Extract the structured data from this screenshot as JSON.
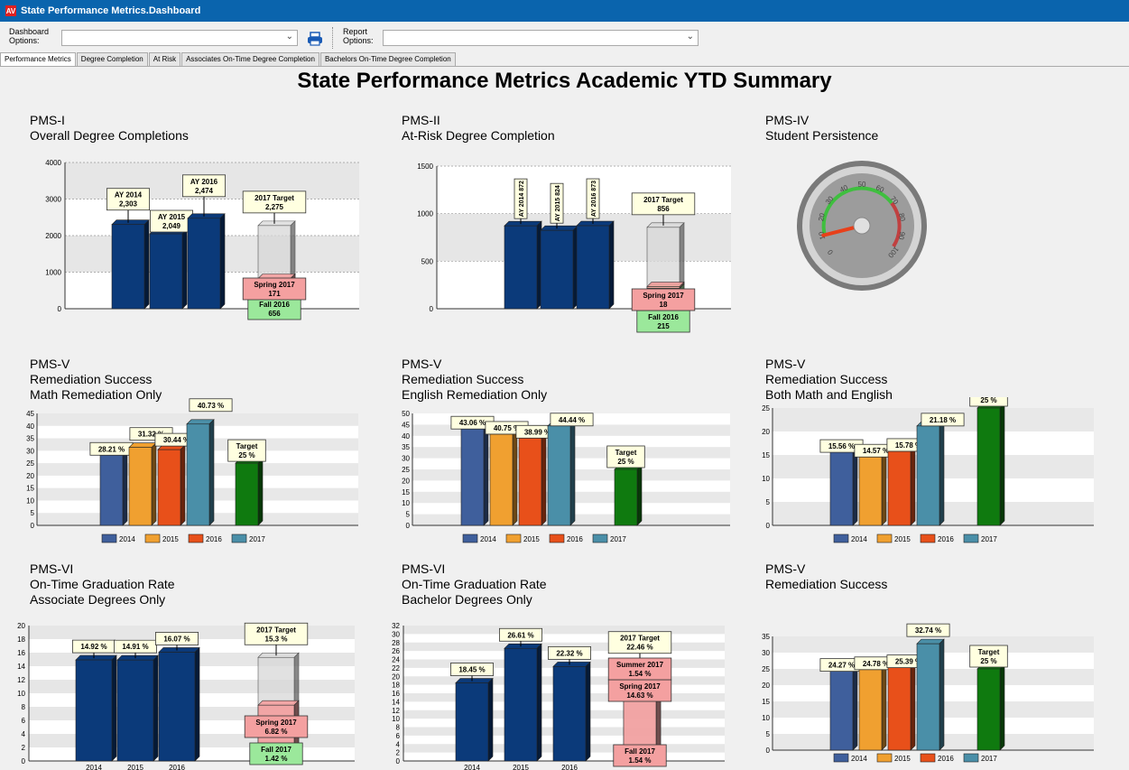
{
  "window": {
    "title": "State Performance Metrics.Dashboard",
    "app_icon": "app-logo-icon"
  },
  "toolbar": {
    "dashboard_label": "Dashboard Options:",
    "dashboard_value": "",
    "report_label": "Report Options:",
    "report_value": "",
    "print_icon": "printer-icon"
  },
  "tabs": [
    {
      "label": "Performance Metrics",
      "active": true
    },
    {
      "label": "Degree Completion"
    },
    {
      "label": "At Risk"
    },
    {
      "label": "Associates On-Time Degree Completion"
    },
    {
      "label": "Bachelors On-Time Degree Completion"
    }
  ],
  "page_title": "State Performance Metrics Academic YTD Summary",
  "panels": {
    "p1": {
      "code": "PMS-I",
      "line1": "Overall Degree Completions",
      "line2": ""
    },
    "p2": {
      "code": "PMS-II",
      "line1": "At-Risk Degree Completion",
      "line2": ""
    },
    "p3": {
      "code": "PMS-IV",
      "line1": "Student Persistence",
      "line2": ""
    },
    "p4": {
      "code": "PMS-V",
      "line1": "Remediation Success",
      "line2": "Math Remediation Only"
    },
    "p5": {
      "code": "PMS-V",
      "line1": "Remediation Success",
      "line2": "English Remediation Only"
    },
    "p6": {
      "code": "PMS-V",
      "line1": "Remediation Success",
      "line2": "Both Math and English"
    },
    "p7": {
      "code": "PMS-VI",
      "line1": "On-Time Graduation Rate",
      "line2": "Associate Degrees Only"
    },
    "p8": {
      "code": "PMS-VI",
      "line1": "On-Time Graduation Rate",
      "line2": "Bachelor Degrees Only"
    },
    "p9": {
      "code": "PMS-V",
      "line1": "Remediation Success",
      "line2": ""
    }
  },
  "colors": {
    "navy": "#0b3a7a",
    "blue": "#3f5f9c",
    "orange": "#f0a030",
    "red": "#e8501a",
    "teal": "#4a8fa8",
    "green": "#0f7a0f",
    "target_gray": "#d8d8d8",
    "spring_pink": "#f4a0a0",
    "fall_green": "#9be89b"
  },
  "chart_data": [
    {
      "id": "pms1",
      "type": "bar",
      "ylim": [
        0,
        4000
      ],
      "yticks": [
        0,
        1000,
        2000,
        3000,
        4000
      ],
      "bars": [
        {
          "label": "AY 2014",
          "value": 2303,
          "value_label": "2,303"
        },
        {
          "label": "AY 2015",
          "value": 2049,
          "value_label": "2,049"
        },
        {
          "label": "AY 2016",
          "value": 2474,
          "value_label": "2,474"
        }
      ],
      "target": {
        "label": "2017 Target",
        "value": 2275,
        "value_label": "2,275"
      },
      "stack": [
        {
          "label": "Fall 2016",
          "value": 656,
          "value_label": "656",
          "color": "fall"
        },
        {
          "label": "Spring 2017",
          "value": 171,
          "value_label": "171",
          "color": "spring"
        }
      ]
    },
    {
      "id": "pms2",
      "type": "bar",
      "ylim": [
        0,
        1500
      ],
      "yticks": [
        0,
        500,
        1000,
        1500
      ],
      "bars": [
        {
          "label": "AY 2014",
          "value": 872,
          "value_label": "872"
        },
        {
          "label": "AY 2015",
          "value": 824,
          "value_label": "824"
        },
        {
          "label": "AY 2016",
          "value": 873,
          "value_label": "873"
        }
      ],
      "target": {
        "label": "2017 Target",
        "value": 856,
        "value_label": "856"
      },
      "stack": [
        {
          "label": "Fall 2016",
          "value": 215,
          "value_label": "215",
          "color": "fall"
        },
        {
          "label": "Spring 2017",
          "value": 18,
          "value_label": "18",
          "color": "spring"
        }
      ]
    },
    {
      "id": "pms4",
      "type": "gauge",
      "tick_labels": [
        "0",
        "10",
        "20",
        "30",
        "40",
        "50",
        "60",
        "70",
        "80",
        "90",
        "100"
      ],
      "needle_value": 10
    },
    {
      "id": "pms5a",
      "type": "bar",
      "ylim": [
        0,
        45
      ],
      "yticks": [
        0,
        5,
        10,
        15,
        20,
        25,
        30,
        35,
        40,
        45
      ],
      "series": [
        {
          "name": "2014",
          "value": 28.21,
          "value_label": "28.21 %"
        },
        {
          "name": "2015",
          "value": 31.32,
          "value_label": "31.32 %"
        },
        {
          "name": "2016",
          "value": 30.44,
          "value_label": "30.44 %"
        },
        {
          "name": "2017",
          "value": 40.73,
          "value_label": "40.73 %"
        }
      ],
      "target": {
        "label": "Target",
        "value": 25,
        "value_label": "25 %"
      }
    },
    {
      "id": "pms5b",
      "type": "bar",
      "ylim": [
        0,
        50
      ],
      "yticks": [
        0,
        5,
        10,
        15,
        20,
        25,
        30,
        35,
        40,
        45,
        50
      ],
      "series": [
        {
          "name": "2014",
          "value": 43.06,
          "value_label": "43.06 %"
        },
        {
          "name": "2015",
          "value": 40.75,
          "value_label": "40.75 %"
        },
        {
          "name": "2016",
          "value": 38.99,
          "value_label": "38.99 %"
        },
        {
          "name": "2017",
          "value": 44.44,
          "value_label": "44.44 %"
        }
      ],
      "target": {
        "label": "Target",
        "value": 25,
        "value_label": "25 %"
      }
    },
    {
      "id": "pms5c",
      "type": "bar",
      "ylim": [
        0,
        25
      ],
      "yticks": [
        0,
        5,
        10,
        15,
        20,
        25
      ],
      "series": [
        {
          "name": "2014",
          "value": 15.56,
          "value_label": "15.56 %"
        },
        {
          "name": "2015",
          "value": 14.57,
          "value_label": "14.57 %"
        },
        {
          "name": "2016",
          "value": 15.78,
          "value_label": "15.78 %"
        },
        {
          "name": "2017",
          "value": 21.18,
          "value_label": "21.18 %"
        }
      ],
      "target": {
        "label": "Target",
        "value": 25,
        "value_label": "25 %"
      }
    },
    {
      "id": "pms6a",
      "type": "bar",
      "ylim": [
        0,
        20
      ],
      "yticks": [
        0,
        2,
        4,
        6,
        8,
        10,
        12,
        14,
        16,
        18,
        20
      ],
      "bars": [
        {
          "label": "2014",
          "value": 14.92,
          "value_label": "14.92 %"
        },
        {
          "label": "2015",
          "value": 14.91,
          "value_label": "14.91 %"
        },
        {
          "label": "2016",
          "value": 16.07,
          "value_label": "16.07 %"
        }
      ],
      "target": {
        "label": "2017 Target",
        "value": 15.3,
        "value_label": "15.3 %"
      },
      "stack": [
        {
          "label": "Fall 2017",
          "value": 1.42,
          "value_label": "1.42 %",
          "color": "fall"
        },
        {
          "label": "Spring 2017",
          "value": 6.82,
          "value_label": "6.82 %",
          "color": "spring"
        }
      ]
    },
    {
      "id": "pms6b",
      "type": "bar",
      "ylim": [
        0,
        32
      ],
      "yticks": [
        0,
        2,
        4,
        6,
        8,
        10,
        12,
        14,
        16,
        18,
        20,
        22,
        24,
        26,
        28,
        30,
        32
      ],
      "bars": [
        {
          "label": "2014",
          "value": 18.45,
          "value_label": "18.45 %"
        },
        {
          "label": "2015",
          "value": 26.61,
          "value_label": "26.61 %"
        },
        {
          "label": "2016",
          "value": 22.32,
          "value_label": "22.32 %"
        }
      ],
      "target": {
        "label": "2017 Target",
        "value": 22.46,
        "value_label": "22.46 %"
      },
      "stack": [
        {
          "label": "Fall 2017",
          "value": 1.54,
          "value_label": "1.54 %",
          "color": "spring"
        },
        {
          "label": "Spring 2017",
          "value": 14.63,
          "value_label": "14.63 %",
          "color": "spring"
        },
        {
          "label": "Summer 2017",
          "value": 1.54,
          "value_label": "1.54 %",
          "color": "spring"
        }
      ]
    },
    {
      "id": "pms5d",
      "type": "bar",
      "ylim": [
        0,
        35
      ],
      "yticks": [
        0,
        5,
        10,
        15,
        20,
        25,
        30,
        35
      ],
      "series": [
        {
          "name": "2014",
          "value": 24.27,
          "value_label": "24.27 %"
        },
        {
          "name": "2015",
          "value": 24.78,
          "value_label": "24.78 %"
        },
        {
          "name": "2016",
          "value": 25.39,
          "value_label": "25.39 %"
        },
        {
          "name": "2017",
          "value": 32.74,
          "value_label": "32.74 %"
        }
      ],
      "target": {
        "label": "Target",
        "value": 25,
        "value_label": "25 %"
      }
    }
  ]
}
